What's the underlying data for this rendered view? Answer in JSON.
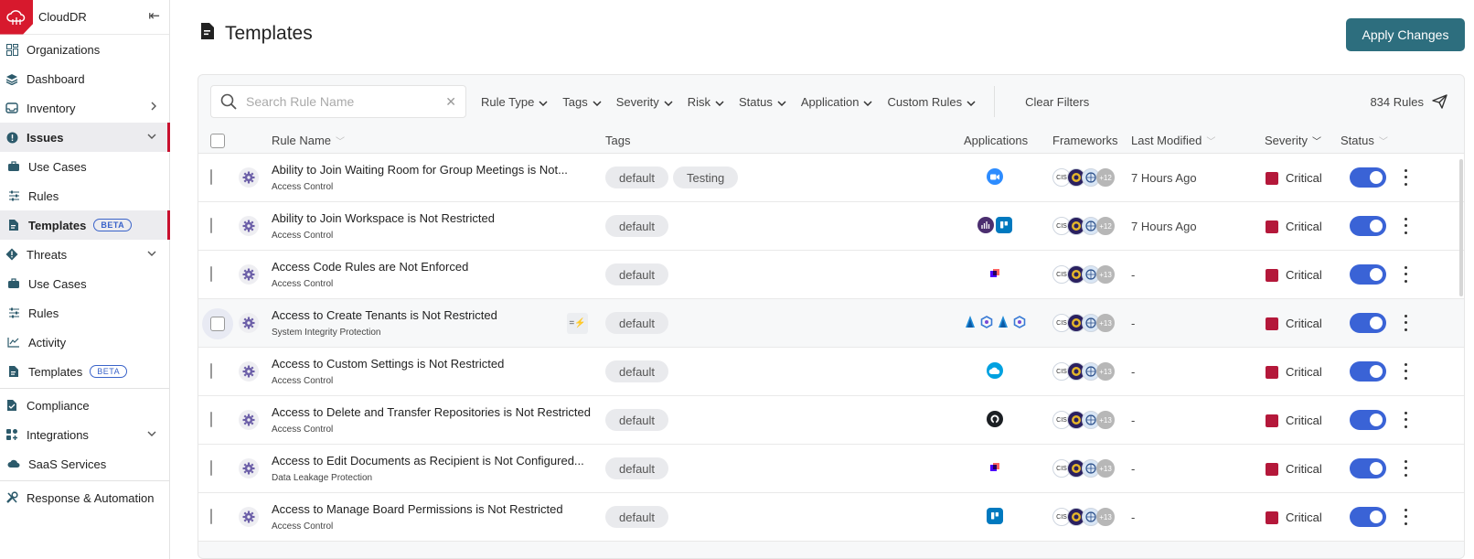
{
  "sidebar": {
    "brand": "CloudDR",
    "items": [
      {
        "label": "Organizations",
        "icon": "grid-icon",
        "sub": false
      },
      {
        "label": "Dashboard",
        "icon": "layers-icon",
        "sub": false
      },
      {
        "label": "Inventory",
        "icon": "inbox-icon",
        "sub": false,
        "chevron": "right"
      },
      {
        "label": "Issues",
        "icon": "alert-circle-icon",
        "sub": false,
        "chevron": "down",
        "active": true
      },
      {
        "label": "Use Cases",
        "icon": "briefcase-icon",
        "sub": true
      },
      {
        "label": "Rules",
        "icon": "sliders-icon",
        "sub": true
      },
      {
        "label": "Templates",
        "icon": "document-icon",
        "sub": true,
        "badge": "BETA",
        "active": true
      },
      {
        "label": "Threats",
        "icon": "diamond-alert-icon",
        "sub": false,
        "chevron": "down"
      },
      {
        "label": "Use Cases",
        "icon": "briefcase-icon",
        "sub": true
      },
      {
        "label": "Rules",
        "icon": "sliders-icon",
        "sub": true
      },
      {
        "label": "Activity",
        "icon": "activity-chart-icon",
        "sub": true
      },
      {
        "label": "Templates",
        "icon": "document-icon",
        "sub": true,
        "badge": "BETA"
      },
      {
        "label": "Compliance",
        "icon": "compliance-doc-icon",
        "sub": false
      },
      {
        "label": "Integrations",
        "icon": "integrations-icon",
        "sub": false,
        "chevron": "down"
      },
      {
        "label": "SaaS Services",
        "icon": "cloud-icon",
        "sub": true
      },
      {
        "label": "Response & Automation",
        "icon": "tools-icon",
        "sub": false
      }
    ]
  },
  "page": {
    "title": "Templates",
    "apply_label": "Apply Changes"
  },
  "filters": {
    "search_placeholder": "Search Rule Name",
    "items": [
      "Rule Type",
      "Tags",
      "Severity",
      "Risk",
      "Status",
      "Application",
      "Custom Rules"
    ],
    "clear_label": "Clear Filters",
    "count_label": "834 Rules"
  },
  "table": {
    "headers": {
      "rule_name": "Rule Name",
      "tags": "Tags",
      "applications": "Applications",
      "frameworks": "Frameworks",
      "last_modified": "Last Modified",
      "severity": "Severity",
      "status": "Status"
    },
    "rows": [
      {
        "name": "Ability to Join Waiting Room for Group Meetings is Not...",
        "category": "Access Control",
        "tags": [
          "default",
          "Testing"
        ],
        "apps": [
          "zoom"
        ],
        "fw_more": "+12",
        "modified": "7 Hours Ago",
        "severity": "Critical"
      },
      {
        "name": "Ability to Join Workspace is Not Restricted",
        "category": "Access Control",
        "tags": [
          "default"
        ],
        "apps": [
          "workplace",
          "trello"
        ],
        "fw_more": "+12",
        "modified": "7 Hours Ago",
        "severity": "Critical"
      },
      {
        "name": "Access Code Rules are Not Enforced",
        "category": "Access Control",
        "tags": [
          "default"
        ],
        "apps": [
          "docusign"
        ],
        "fw_more": "+13",
        "modified": "-",
        "severity": "Critical"
      },
      {
        "name": "Access to Create Tenants is Not Restricted",
        "category": "System Integrity Protection",
        "tags": [
          "default"
        ],
        "apps": [
          "entra",
          "hex",
          "entra",
          "hex"
        ],
        "fw_more": "+13",
        "modified": "-",
        "severity": "Critical",
        "hover": true,
        "ai_chip": "=⚡"
      },
      {
        "name": "Access to Custom Settings is Not Restricted",
        "category": "Access Control",
        "tags": [
          "default"
        ],
        "apps": [
          "salesforce"
        ],
        "fw_more": "+13",
        "modified": "-",
        "severity": "Critical"
      },
      {
        "name": "Access to Delete and Transfer Repositories is Not Restricted",
        "category": "Access Control",
        "tags": [
          "default"
        ],
        "apps": [
          "github"
        ],
        "fw_more": "+13",
        "modified": "-",
        "severity": "Critical"
      },
      {
        "name": "Access to Edit Documents as Recipient is Not Configured...",
        "category": "Data Leakage Protection",
        "tags": [
          "default"
        ],
        "apps": [
          "docusign"
        ],
        "fw_more": "+13",
        "modified": "-",
        "severity": "Critical"
      },
      {
        "name": "Access to Manage Board Permissions is Not Restricted",
        "category": "Access Control",
        "tags": [
          "default"
        ],
        "apps": [
          "trello"
        ],
        "fw_more": "+13",
        "modified": "-",
        "severity": "Critical"
      }
    ],
    "fw_badge": "CIS"
  },
  "colors": {
    "brand_red": "#d7192d",
    "teal_button": "#2d6e7e",
    "toggle_blue": "#3a63d6",
    "critical": "#b4183a"
  }
}
